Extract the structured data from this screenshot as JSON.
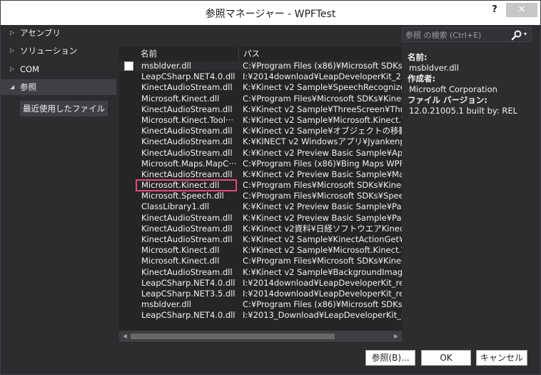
{
  "window": {
    "title": "参照マネージャー - WPFTest",
    "help": "?",
    "close": "✕"
  },
  "sidebar": {
    "items": [
      {
        "label": "アセンブリ",
        "expander": "▷"
      },
      {
        "label": "ソリューション",
        "expander": "▷"
      },
      {
        "label": "COM",
        "expander": "▷"
      },
      {
        "label": "参照",
        "expander": "◢"
      }
    ],
    "subitem": "最近使用したファイル"
  },
  "columns": {
    "name": "名前",
    "path": "パス"
  },
  "rows": [
    {
      "name": "msbldver.dll",
      "path": "C:¥Program Files (x86)¥Microsoft SDKs¥"
    },
    {
      "name": "LeapCSharp.NET4.0.dll",
      "path": "I:¥2014download¥LeapDeveloperKit_2.0"
    },
    {
      "name": "KinectAudioStream.dll",
      "path": "K:¥Kinect v2 Sample¥SpeechRecognize¥"
    },
    {
      "name": "Microsoft.Kinect.dll",
      "path": "C:¥Program Files¥Microsoft SDKs¥Kinec"
    },
    {
      "name": "KinectAudioStream.dll",
      "path": "K:¥Kinect v2 Sample¥ThreeScreen¥Thre"
    },
    {
      "name": "Microsoft.Kinect.Tool···",
      "path": "K:¥Kinect v2 Sample¥Microsoft.Kinect.T"
    },
    {
      "name": "KinectAudioStream.dll",
      "path": "K:¥Kinect v2 Sample¥オブジェクトの移動¥Ki"
    },
    {
      "name": "KinectAudioStream.dll",
      "path": "K:¥KINECT v2 Windowsアプリ¥Jyankenpo"
    },
    {
      "name": "KinectAudioStream.dll",
      "path": "K:¥Kinect v2 Preview Basic Sample¥App"
    },
    {
      "name": "Microsoft.Maps.MapC···",
      "path": "C:¥Program Files (x86)¥Bing Maps WPF"
    },
    {
      "name": "KinectAudioStream.dll",
      "path": "K:¥Kinect v2 Preview Basic Sample¥Mas"
    },
    {
      "name": "Microsoft.Kinect.dll",
      "path": "C:¥Program Files¥Microsoft SDKs¥Kinec"
    },
    {
      "name": "Microsoft.Speech.dll",
      "path": "C:¥Program Files¥Microsoft SDKs¥Speec"
    },
    {
      "name": "ClassLibrary1.dll",
      "path": "K:¥Kinect v2 Preview Basic Sample¥Par"
    },
    {
      "name": "KinectAudioStream.dll",
      "path": "K:¥Kinect v2 Preview Basic Sample¥Pair"
    },
    {
      "name": "KinectAudioStream.dll",
      "path": "K:¥Kinect v2資料¥日経ソフトウエアKinect v"
    },
    {
      "name": "KinectAudioStream.dll",
      "path": "K:¥Kinect v2 Sample¥KinectActionGet¥K"
    },
    {
      "name": "Microsoft.Kinect.dll",
      "path": "K:¥Kinect v2 Sample¥Microsoft.Kinect.T"
    },
    {
      "name": "Microsoft.Kinect.dll",
      "path": "C:¥Program Files¥Microsoft SDKs¥Kinec"
    },
    {
      "name": "KinectAudioStream.dll",
      "path": "K:¥Kinect v2 Sample¥BackgroundImage"
    },
    {
      "name": "LeapCSharp.NET4.0.dll",
      "path": "I:¥2014download¥LeapDeveloperKit_rel"
    },
    {
      "name": "LeapCSharp.NET3.5.dll",
      "path": "I:¥2014download¥LeapDeveloperKit_rel"
    },
    {
      "name": "msbldver.dll",
      "path": "C:¥Program Files (x86)¥Microsoft SDKs¥"
    },
    {
      "name": "LeapCSharp.NET4.0.dll",
      "path": "I:¥2013_Download¥LeapDeveloperKit_re"
    }
  ],
  "highlighted_row": "Microsoft.Kinect.dll",
  "scrollbar": {
    "left": "◀",
    "right": "▶"
  },
  "search": {
    "placeholder": "参照 の検索 (Ctrl+E)",
    "icon": "search-icon",
    "dropdown": "▾"
  },
  "details": {
    "name_label": "名前:",
    "name_value": "msbldver.dll",
    "author_label": "作成者:",
    "author_value": "Microsoft Corporation",
    "version_label": "ファイル バージョン:",
    "version_value": "12.0.21005.1 built by: REL"
  },
  "buttons": {
    "browse": "参照(B)...",
    "ok": "OK",
    "cancel": "キャンセル"
  },
  "colors": {
    "window_bg": "#2d2d30",
    "list_bg": "#252526",
    "highlight": "#e8457e",
    "selected": "#3f3f46"
  }
}
